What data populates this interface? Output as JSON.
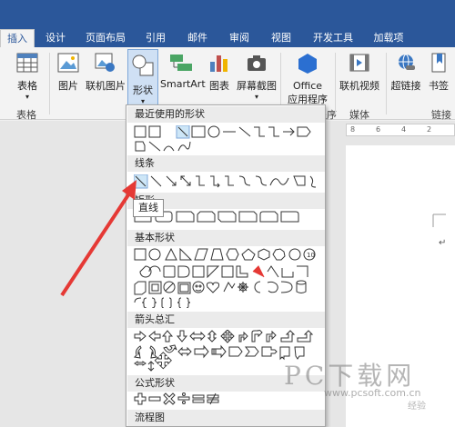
{
  "tabs": [
    {
      "label": "插入",
      "active": true
    },
    {
      "label": "设计"
    },
    {
      "label": "页面布局"
    },
    {
      "label": "引用"
    },
    {
      "label": "邮件"
    },
    {
      "label": "审阅"
    },
    {
      "label": "视图"
    },
    {
      "label": "开发工具"
    },
    {
      "label": "加载项"
    }
  ],
  "ribbon": {
    "table": "表格",
    "picture": "图片",
    "online_picture": "联机图片",
    "shapes": "形状",
    "smartart": "SmartArt",
    "chart": "图表",
    "screenshot": "屏幕截图",
    "office_apps_line1": "Office",
    "office_apps_line2": "应用程序",
    "online_video": "联机视频",
    "hyperlink": "超链接",
    "bookmark": "书签",
    "group_table": "表格",
    "group_apps": "程序",
    "group_media": "媒体",
    "group_links": "链接",
    "dropdown_caret": "▾"
  },
  "shapes_menu": {
    "recent": "最近使用的形状",
    "lines": "线条",
    "rect": "矩形",
    "basic": "基本形状",
    "arrows": "箭头总汇",
    "formula": "公式形状",
    "flowchart": "流程图",
    "tooltip": "直线"
  },
  "ruler": [
    "8",
    "6",
    "4",
    "2"
  ],
  "watermark": {
    "brand": "PC下载网",
    "url": "www.pcsoft.com.cn",
    "tag": "经验"
  },
  "colors": {
    "tabbar": "#2b579a",
    "accent_arrow": "#e53935"
  }
}
